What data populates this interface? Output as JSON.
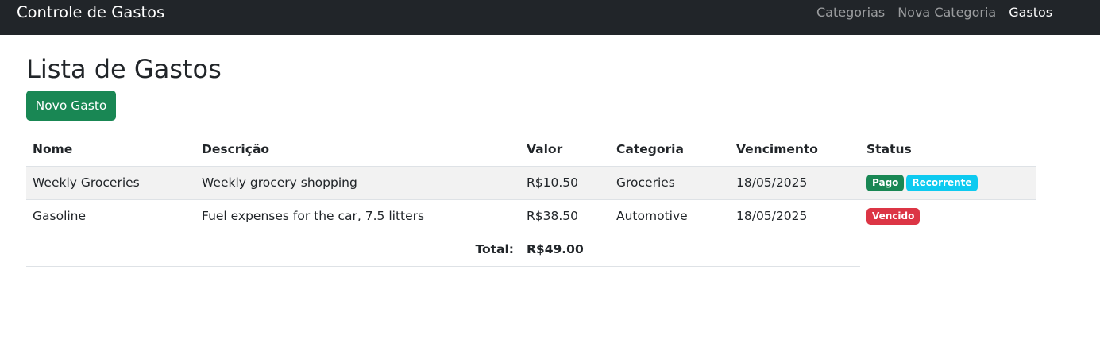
{
  "navbar": {
    "brand": "Controle de Gastos",
    "links": [
      {
        "label": "Categorias",
        "active": false
      },
      {
        "label": "Nova Categoria",
        "active": false
      },
      {
        "label": "Gastos",
        "active": true
      }
    ]
  },
  "page": {
    "title": "Lista de Gastos",
    "new_button": "Novo Gasto"
  },
  "table": {
    "headers": [
      "Nome",
      "Descrição",
      "Valor",
      "Categoria",
      "Vencimento",
      "Status"
    ],
    "rows": [
      {
        "nome": "Weekly Groceries",
        "descricao": "Weekly grocery shopping",
        "valor": "R$10.50",
        "categoria": "Groceries",
        "vencimento": "18/05/2025",
        "status": [
          {
            "label": "Pago",
            "color": "#198754"
          },
          {
            "label": "Recorrente",
            "color": "#0dcaf0"
          }
        ]
      },
      {
        "nome": "Gasoline",
        "descricao": "Fuel expenses for the car, 7.5 litters",
        "valor": "R$38.50",
        "categoria": "Automotive",
        "vencimento": "18/05/2025",
        "status": [
          {
            "label": "Vencido",
            "color": "#dc3545"
          }
        ]
      }
    ],
    "total_label": "Total:",
    "total_value": "R$49.00"
  }
}
